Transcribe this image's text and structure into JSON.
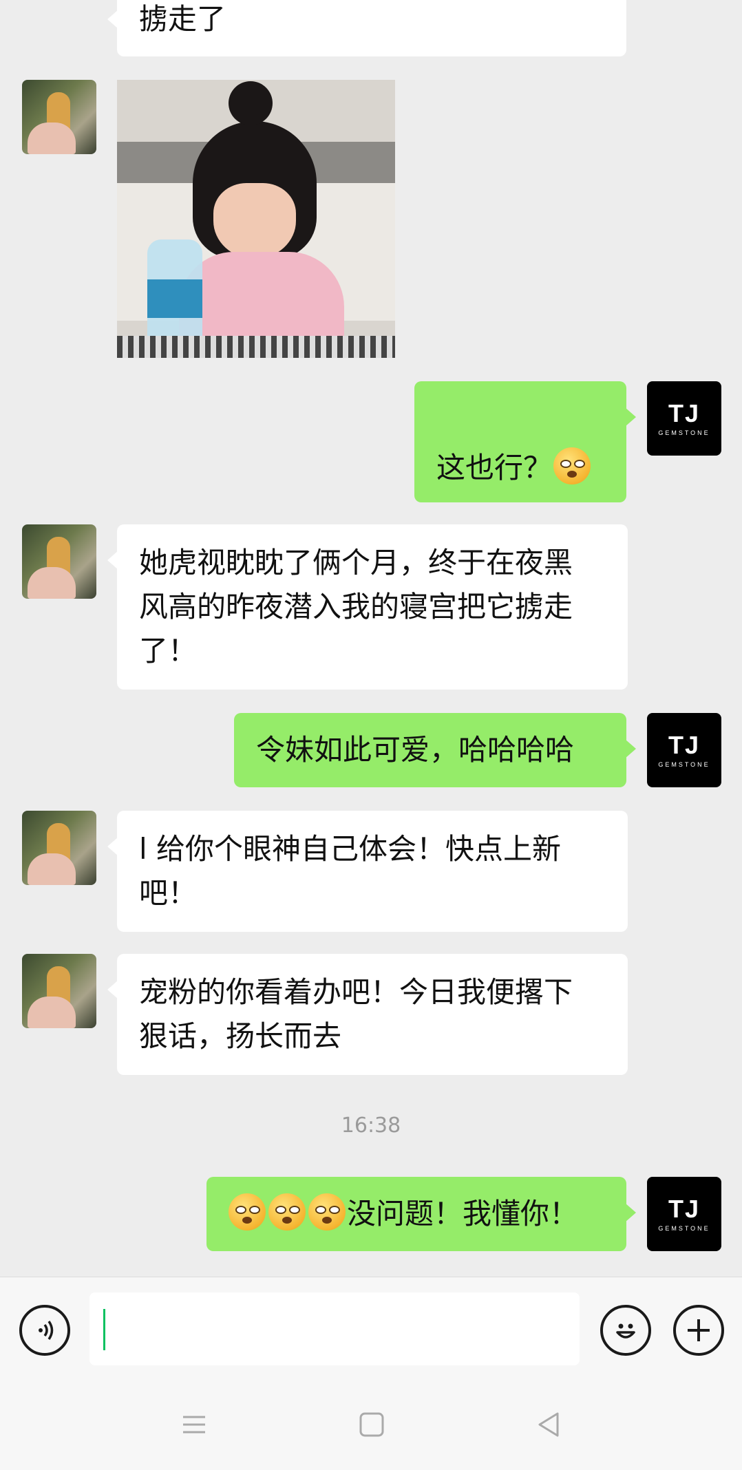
{
  "messages": [
    {
      "side": "in",
      "type": "text",
      "text": "掳走了"
    },
    {
      "side": "in",
      "type": "image"
    },
    {
      "side": "out",
      "type": "text",
      "text": "这也行？"
    },
    {
      "side": "in",
      "type": "text",
      "text_lines": [
        "她虎视眈眈了俩个月，终于在夜黑",
        "风高的昨夜潜入我的寝宫把它掳走",
        "了！"
      ]
    },
    {
      "side": "out",
      "type": "text",
      "text": "令妹如此可爱，哈哈哈哈"
    },
    {
      "side": "in",
      "type": "text",
      "text_lines": [
        "l 给你个眼神自己体会！快点上新",
        "吧！"
      ]
    },
    {
      "side": "in",
      "type": "text",
      "text_lines": [
        "宠粉的你看着办吧！今日我便撂下",
        "狠话，扬长而去"
      ]
    },
    {
      "side": "out",
      "type": "text",
      "text": "没问题！我懂你！"
    }
  ],
  "timestamp": "16:38",
  "self_avatar": {
    "logo": "TJ",
    "sub": "GEMSTONE"
  },
  "input": {
    "value": ""
  },
  "icons": {
    "voice": "voice-icon",
    "emoji": "emoji-icon",
    "plus": "plus-icon",
    "menu": "menu-icon",
    "home": "home-icon",
    "back": "back-icon"
  },
  "colors": {
    "outgoing_bubble": "#95ec69",
    "incoming_bubble": "#ffffff",
    "background": "#ededed"
  }
}
